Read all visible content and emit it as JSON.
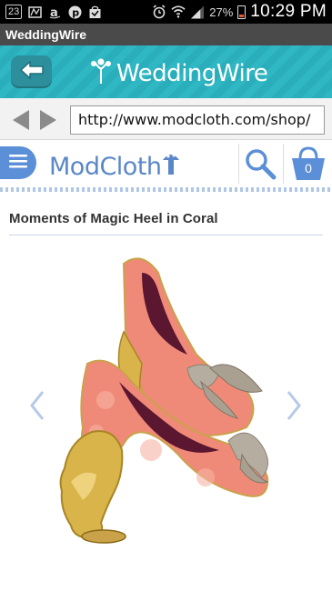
{
  "status_bar": {
    "notification_badge": "23",
    "battery_percent": "27%",
    "time": "10:29 PM",
    "icons": [
      "notification-badge",
      "app-icon",
      "amazon-icon",
      "pinterest-icon",
      "shopping-bag-icon",
      "alarm-icon",
      "wifi-icon",
      "signal-icon",
      "battery-icon"
    ]
  },
  "app": {
    "title": "WeddingWire"
  },
  "header": {
    "logo_text": "WeddingWire",
    "back_icon": "back-arrow-icon"
  },
  "browser": {
    "url": "http://www.modcloth.com/shop/"
  },
  "site_header": {
    "logo_text": "ModCloth",
    "cart_count": "0"
  },
  "product": {
    "title": "Moments of Magic Heel in Coral"
  },
  "colors": {
    "teal_header": "#2fb7c4",
    "modcloth_blue": "#5b8fd8",
    "coral": "#f08a78",
    "gold": "#d9b44a"
  }
}
